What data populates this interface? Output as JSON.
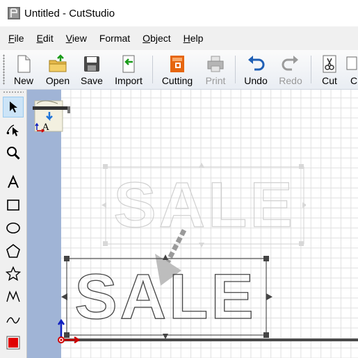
{
  "window": {
    "title": "Untitled - CutStudio"
  },
  "menu": [
    {
      "label": "File",
      "u": "F",
      "rest": "ile"
    },
    {
      "label": "Edit",
      "u": "E",
      "rest": "dit"
    },
    {
      "label": "View",
      "u": "V",
      "rest": "iew"
    },
    {
      "label": "Format",
      "u": "",
      "rest": "Format"
    },
    {
      "label": "Object",
      "u": "O",
      "rest": "bject"
    },
    {
      "label": "Help",
      "u": "H",
      "rest": "elp"
    }
  ],
  "toolbar": {
    "new": "New",
    "open": "Open",
    "save": "Save",
    "import": "Import",
    "cutting": "Cutting",
    "print": "Print",
    "undo": "Undo",
    "redo": "Redo",
    "cut": "Cut",
    "copy": "C"
  },
  "canvas": {
    "ghost_text": "SALE",
    "selected_text": "SALE",
    "accent_color": "#e00000"
  }
}
